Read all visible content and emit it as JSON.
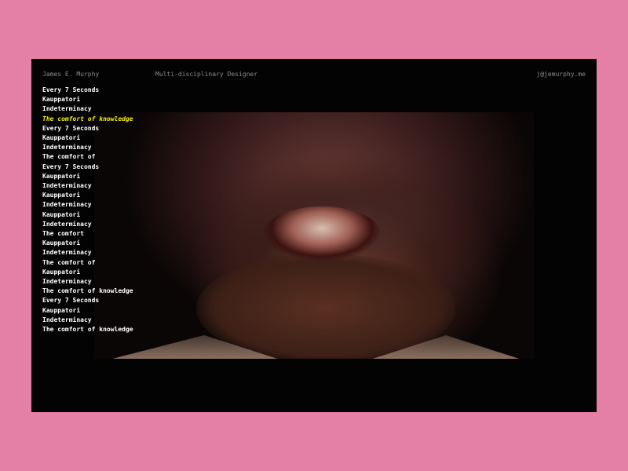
{
  "header": {
    "name": "James E. Murphy",
    "role": "Multi-disciplinary Designer",
    "email": "j@jemurphy.me"
  },
  "projects": [
    "Every 7 Seconds",
    "Kauppatori",
    "Indeterminacy",
    "The comfort of knowledge",
    "Every 7 Seconds",
    "Kauppatori",
    "Indeterminacy",
    "The comfort of",
    "Every 7 Seconds",
    "Kauppatori",
    "Indeterminacy",
    "Kauppatori",
    "Indeterminacy",
    "Kauppatori",
    "Indeterminacy",
    "The comfort",
    "Kauppatori",
    "Indeterminacy",
    "The comfort of",
    "Kauppatori",
    "Indeterminacy",
    "The comfort of knowledge",
    "Every 7 Seconds",
    "Kauppatori",
    "Indeterminacy",
    "The comfort of knowledge"
  ],
  "active_index": 3,
  "colors": {
    "background": "#e47fa6",
    "frame": "#030303",
    "active": "#f4f000"
  }
}
